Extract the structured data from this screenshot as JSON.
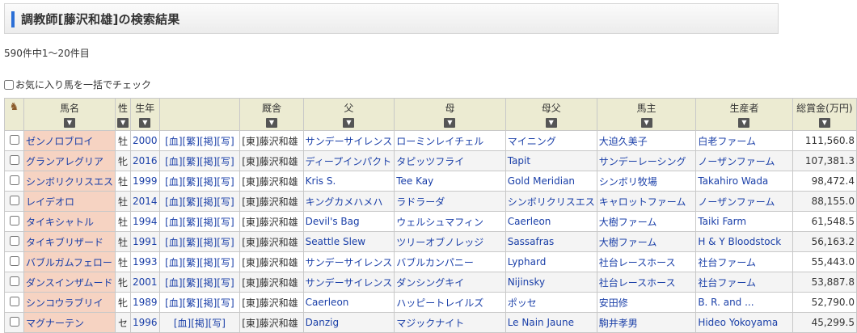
{
  "header": {
    "title": "調教師[藤沢和雄]の検索結果"
  },
  "count_text": "590件中1～20件目",
  "bulk_label": "お気に入り馬を一括でチェック",
  "columns": {
    "horse": "馬名",
    "sex": "性",
    "year": "生年",
    "stable": "厩舎",
    "sire": "父",
    "dam": "母",
    "damsire": "母父",
    "owner": "馬主",
    "breeder": "生産者",
    "prize": "総賞金(万円)"
  },
  "icons": {
    "sort": "triangle-down-icon",
    "horse": "horse-icon"
  },
  "rows": [
    {
      "name": "ゼンノロブロイ",
      "sex": "牡",
      "year": "2000",
      "links": [
        "[血]",
        "[繁]",
        "[掲]",
        "[写]"
      ],
      "stable": "[東]藤沢和雄",
      "sire": "サンデーサイレンス",
      "dam": "ローミンレイチェル",
      "damsire": "マイニング",
      "owner": "大迫久美子",
      "breeder": "白老ファーム",
      "prize": "111,560.8"
    },
    {
      "name": "グランアレグリア",
      "sex": "牝",
      "year": "2016",
      "links": [
        "[血]",
        "[繁]",
        "[掲]",
        "[写]"
      ],
      "stable": "[東]藤沢和雄",
      "sire": "ディープインパクト",
      "dam": "タピッツフライ",
      "damsire": "Tapit",
      "owner": "サンデーレーシング",
      "breeder": "ノーザンファーム",
      "prize": "107,381.3"
    },
    {
      "name": "シンボリクリスエス",
      "sex": "牡",
      "year": "1999",
      "links": [
        "[血]",
        "[繁]",
        "[掲]",
        "[写]"
      ],
      "stable": "[東]藤沢和雄",
      "sire": "Kris S.",
      "dam": "Tee Kay",
      "damsire": "Gold Meridian",
      "owner": "シンボリ牧場",
      "breeder": "Takahiro Wada",
      "prize": "98,472.4"
    },
    {
      "name": "レイデオロ",
      "sex": "牡",
      "year": "2014",
      "links": [
        "[血]",
        "[繁]",
        "[掲]",
        "[写]"
      ],
      "stable": "[東]藤沢和雄",
      "sire": "キングカメハメハ",
      "dam": "ラドラーダ",
      "damsire": "シンボリクリスエス",
      "owner": "キャロットファーム",
      "breeder": "ノーザンファーム",
      "prize": "88,155.0"
    },
    {
      "name": "タイキシャトル",
      "sex": "牡",
      "year": "1994",
      "links": [
        "[血]",
        "[繁]",
        "[掲]",
        "[写]"
      ],
      "stable": "[東]藤沢和雄",
      "sire": "Devil's Bag",
      "dam": "ウェルシュマフィン",
      "damsire": "Caerleon",
      "owner": "大樹ファーム",
      "breeder": "Taiki Farm",
      "prize": "61,548.5"
    },
    {
      "name": "タイキブリザード",
      "sex": "牡",
      "year": "1991",
      "links": [
        "[血]",
        "[繁]",
        "[掲]",
        "[写]"
      ],
      "stable": "[東]藤沢和雄",
      "sire": "Seattle Slew",
      "dam": "ツリーオブノレッジ",
      "damsire": "Sassafras",
      "owner": "大樹ファーム",
      "breeder": "H & Y Bloodstock",
      "prize": "56,163.2"
    },
    {
      "name": "バブルガムフェロー",
      "sex": "牡",
      "year": "1993",
      "links": [
        "[血]",
        "[繁]",
        "[掲]",
        "[写]"
      ],
      "stable": "[東]藤沢和雄",
      "sire": "サンデーサイレンス",
      "dam": "バブルカンパニー",
      "damsire": "Lyphard",
      "owner": "社台レースホース",
      "breeder": "社台ファーム",
      "prize": "55,443.0"
    },
    {
      "name": "ダンスインザムード",
      "sex": "牝",
      "year": "2001",
      "links": [
        "[血]",
        "[繁]",
        "[掲]",
        "[写]"
      ],
      "stable": "[東]藤沢和雄",
      "sire": "サンデーサイレンス",
      "dam": "ダンシングキイ",
      "damsire": "Nijinsky",
      "owner": "社台レースホース",
      "breeder": "社台ファーム",
      "prize": "53,887.8"
    },
    {
      "name": "シンコウラブリイ",
      "sex": "牝",
      "year": "1989",
      "links": [
        "[血]",
        "[繁]",
        "[掲]",
        "[写]"
      ],
      "stable": "[東]藤沢和雄",
      "sire": "Caerleon",
      "dam": "ハッピートレイルズ",
      "damsire": "ポッセ",
      "owner": "安田修",
      "breeder": "B. R. and ...",
      "prize": "52,790.0"
    },
    {
      "name": "マグナーテン",
      "sex": "セ",
      "year": "1996",
      "links": [
        "[血]",
        "[掲]",
        "[写]"
      ],
      "stable": "[東]藤沢和雄",
      "sire": "Danzig",
      "dam": "マジックナイト",
      "damsire": "Le Nain Jaune",
      "owner": "駒井孝男",
      "breeder": "Hideo Yokoyama",
      "prize": "45,299.5"
    }
  ]
}
